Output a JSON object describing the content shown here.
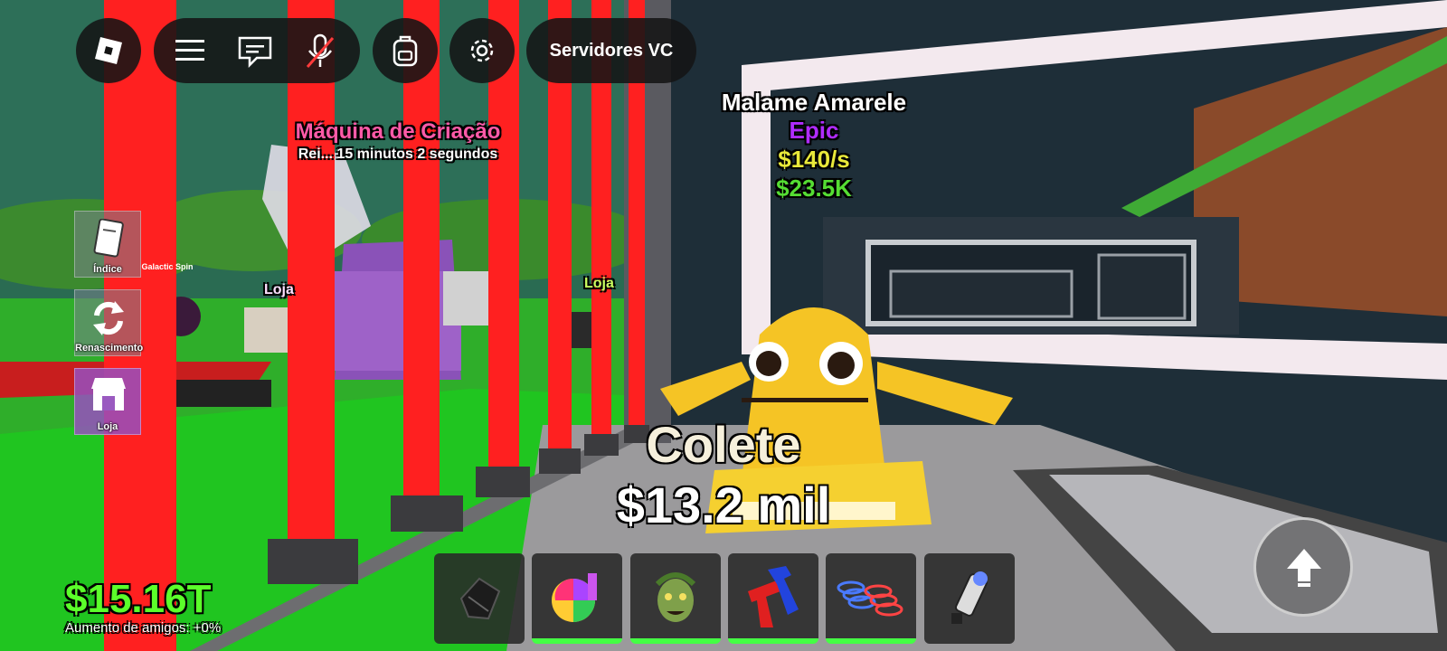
{
  "topbar": {
    "roblox_icon": "roblox-logo-icon",
    "menu_icon": "hamburger-menu-icon",
    "chat_icon": "chat-icon",
    "mic_icon": "microphone-muted-icon",
    "backpack_icon": "backpack-icon",
    "settings_icon": "gear-icon",
    "servers_label": "Servidores VC"
  },
  "side_menu": [
    {
      "label": "Índice",
      "icon": "book-icon"
    },
    {
      "label": "Renascimento",
      "icon": "rebirth-arrows-icon"
    },
    {
      "label": "Loja",
      "icon": "shop-icon"
    }
  ],
  "machine": {
    "title": "Máquina de Criação",
    "subtitle": "Rei... 15 minutos 2 segundos"
  },
  "small_signs": {
    "left_shop": "Loja",
    "right_shop": "Loja",
    "galactic": "Galactic Spin"
  },
  "pet": {
    "name": "Malame Amarele",
    "rarity": "Epic",
    "rate": "$140/s",
    "price": "$23.5K"
  },
  "collect": {
    "label": "Colete",
    "amount": "$13.2 mil"
  },
  "money": {
    "balance": "$15.16T",
    "friends_boost": "Aumento de amigos: +0%"
  },
  "hotbar": [
    {
      "icon": "dark-gloves-icon",
      "equipped": false
    },
    {
      "icon": "disco-ball-icon",
      "equipped": true
    },
    {
      "icon": "medusa-head-icon",
      "equipped": true
    },
    {
      "icon": "red-blue-figure-icon",
      "equipped": true
    },
    {
      "icon": "spring-coils-icon",
      "equipped": true
    },
    {
      "icon": "flashlight-icon",
      "equipped": false
    }
  ],
  "jump_icon": "jump-arrow-icon",
  "colors": {
    "laser": "#ff2020",
    "money_green": "#5bff2a",
    "epic_purple": "#b02cff",
    "rate_yellow": "#e8e83a",
    "price_green": "#55dd33"
  }
}
